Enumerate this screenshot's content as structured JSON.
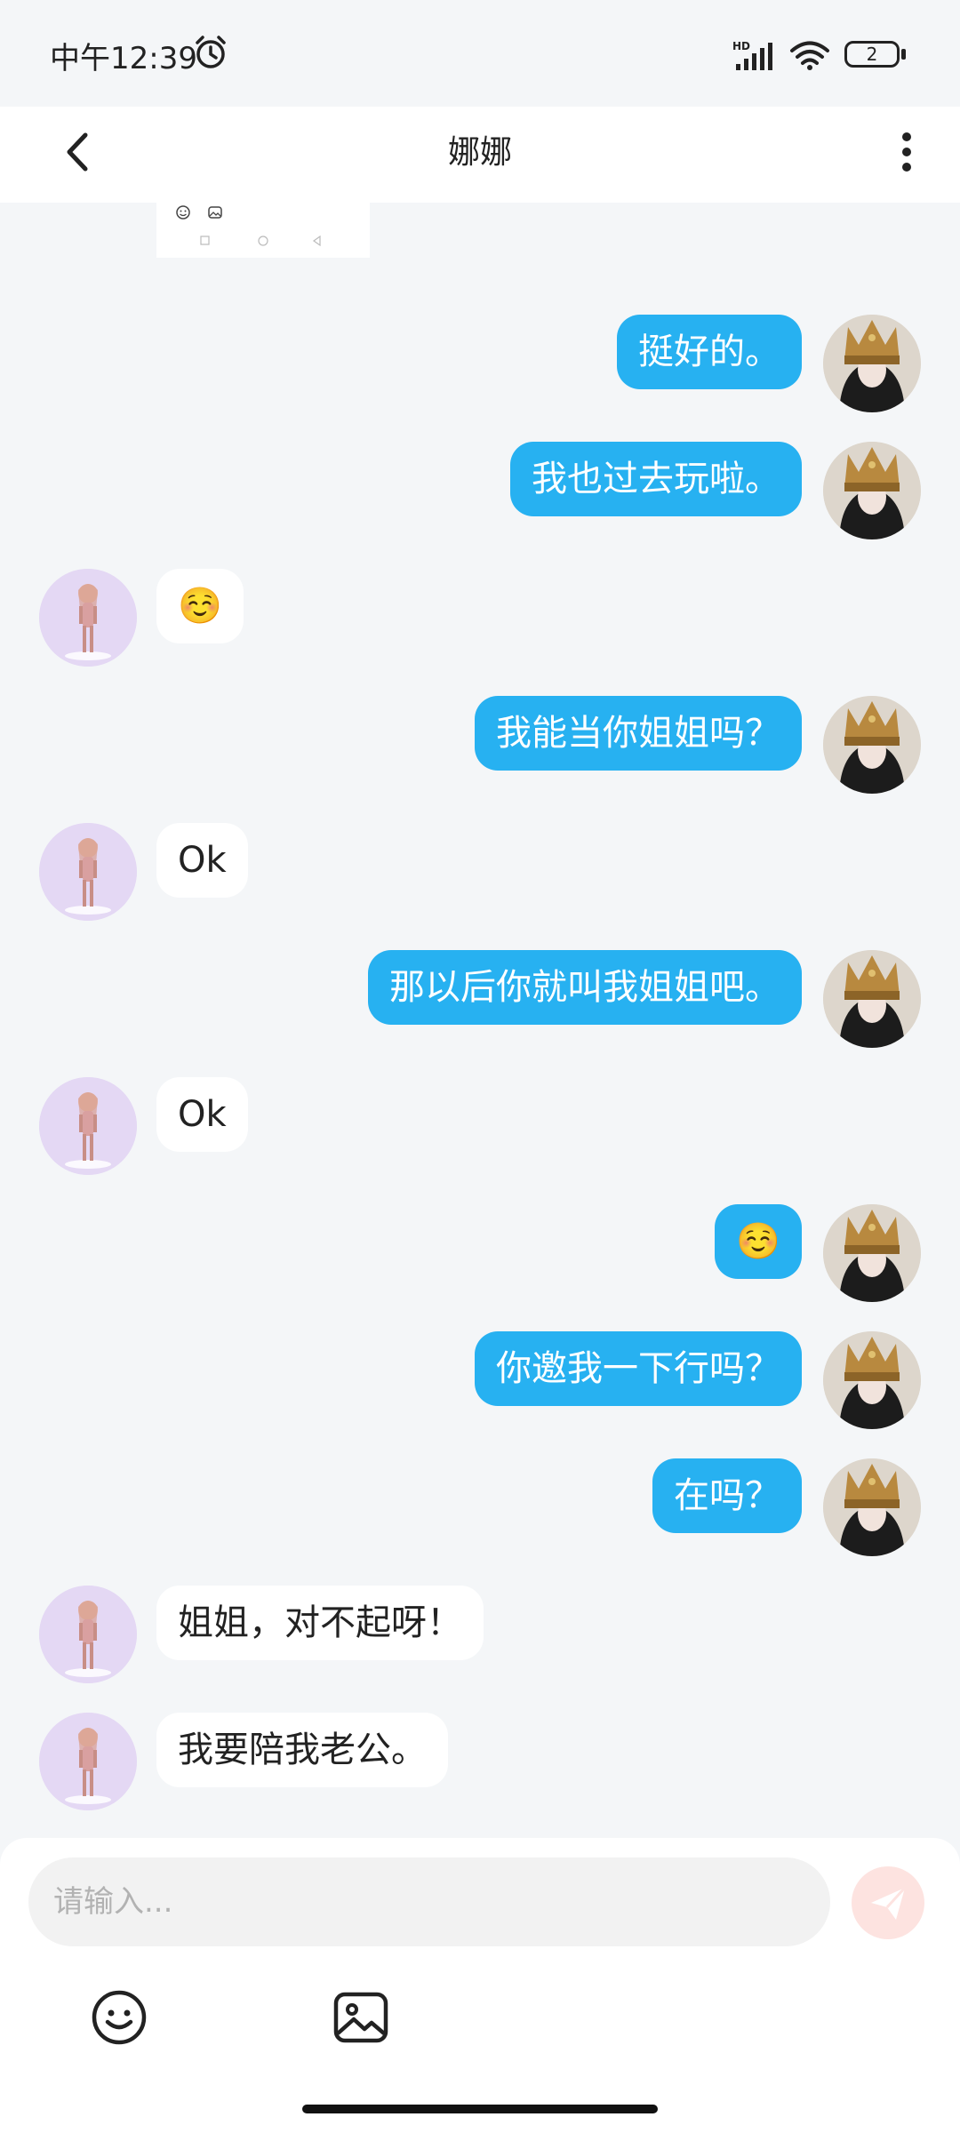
{
  "status_bar": {
    "time": "中午12:39",
    "network_label": "HD",
    "battery_level": "2"
  },
  "header": {
    "title": "娜娜"
  },
  "messages": [
    {
      "from": "self",
      "text": "挺好的。"
    },
    {
      "from": "self",
      "text": "我也过去玩啦。"
    },
    {
      "from": "other",
      "text": "☺️"
    },
    {
      "from": "self",
      "text": "我能当你姐姐吗？"
    },
    {
      "from": "other",
      "text": "Ok"
    },
    {
      "from": "self",
      "text": "那以后你就叫我姐姐吧。"
    },
    {
      "from": "other",
      "text": "Ok"
    },
    {
      "from": "self",
      "text": "☺️"
    },
    {
      "from": "self",
      "text": "你邀我一下行吗？"
    },
    {
      "from": "self",
      "text": "在吗？"
    },
    {
      "from": "other",
      "text": "姐姐，对不起呀！"
    },
    {
      "from": "other",
      "text": "我要陪我老公。"
    }
  ],
  "input": {
    "placeholder": "请输入..."
  },
  "icons": {
    "back": "chevron-left-icon",
    "more": "more-vertical-icon",
    "send": "paper-plane-icon",
    "emoji": "smiley-icon",
    "image": "image-icon",
    "alarm": "alarm-clock-icon",
    "wifi": "wifi-icon",
    "signal": "signal-icon"
  },
  "colors": {
    "self_bubble": "#27b1f1",
    "other_bubble": "#ffffff",
    "background": "#f4f6f8",
    "send_button": "#fde3e0"
  }
}
